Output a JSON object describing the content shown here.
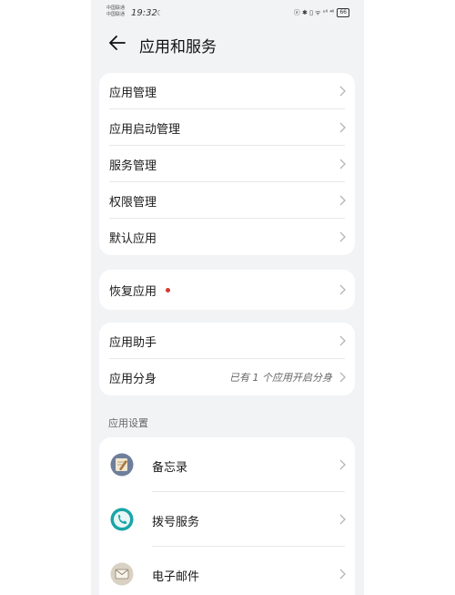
{
  "statusbar": {
    "carrier_1": "中国联通",
    "carrier_2": "中国联通",
    "time": "19:32",
    "dnd_icon": "moon-icon",
    "network_icons": "ⓧ ✱ ▯ ᯤ ᵒˡˡ ⁴ˡˡ",
    "battery": "66"
  },
  "header": {
    "title": "应用和服务"
  },
  "group1": {
    "items": [
      {
        "label": "应用管理"
      },
      {
        "label": "应用启动管理"
      },
      {
        "label": "服务管理"
      },
      {
        "label": "权限管理"
      },
      {
        "label": "默认应用"
      }
    ]
  },
  "group2": {
    "items": [
      {
        "label": "恢复应用",
        "badge_color": "#d23b2f"
      }
    ]
  },
  "group3": {
    "items": [
      {
        "label": "应用助手"
      },
      {
        "label": "应用分身",
        "value": "已有 1 个应用开启分身"
      }
    ]
  },
  "section": {
    "title": "应用设置"
  },
  "apps": {
    "items": [
      {
        "label": "备忘录",
        "icon": "memo-icon"
      },
      {
        "label": "拨号服务",
        "icon": "phone-icon"
      },
      {
        "label": "电子邮件",
        "icon": "email-icon"
      }
    ]
  }
}
